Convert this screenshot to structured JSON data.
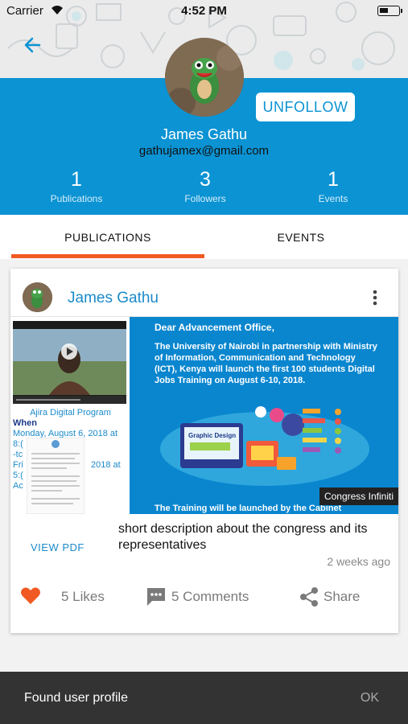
{
  "status_bar": {
    "carrier": "Carrier",
    "time": "4:52 PM"
  },
  "profile": {
    "name": "James  Gathu",
    "email": "gathujamex@gmail.com",
    "follow_button": "UNFOLLOW",
    "stats": [
      {
        "value": "1",
        "label": "Publications"
      },
      {
        "value": "3",
        "label": "Followers"
      },
      {
        "value": "1",
        "label": "Events"
      }
    ]
  },
  "tabs": [
    {
      "label": "PUBLICATIONS",
      "active": true
    },
    {
      "label": "EVENTS",
      "active": false
    }
  ],
  "post": {
    "author": "James  Gathu",
    "doc": {
      "title": "Ajira Digital Program",
      "when_label": "When",
      "when_lines": [
        "Monday, August 6, 2018 at",
        "8:(",
        "-tc",
        "Fri",
        "2018 at",
        "5:(",
        "Ac"
      ]
    },
    "flyer": {
      "salutation": "Dear Advancement Office,",
      "body": "The University of Nairobi in partnership with Ministry of Information, Communication and Technology (ICT), Kenya will launch the first 100 students Digital Jobs Training on August 6-10, 2018.",
      "screen_label": "Graphic Design",
      "footer": "The Training will be launched by the Cabinet",
      "badge": "Congress Infiniti"
    },
    "view_pdf": "VIEW PDF",
    "description": "short description about the congress and its representatives",
    "time_ago": "2 weeks ago",
    "likes": "5 Likes",
    "comments": "5 Comments",
    "share": "Share"
  },
  "snackbar": {
    "message": "Found user profile",
    "action": "OK"
  },
  "colors": {
    "primary": "#0b93d3",
    "accent": "#f05a22",
    "like": "#f05a22"
  }
}
